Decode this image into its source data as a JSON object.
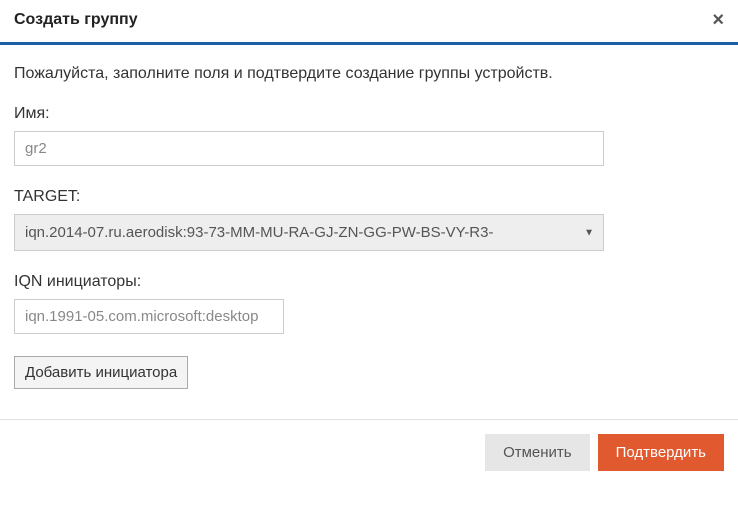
{
  "header": {
    "title": "Создать группу",
    "close_symbol": "×"
  },
  "body": {
    "description": "Пожалуйста, заполните поля и подтвердите создание группы устройств.",
    "name_label": "Имя:",
    "name_value": "gr2",
    "target_label": "TARGET:",
    "target_value": "iqn.2014-07.ru.aerodisk:93-73-MM-MU-RA-GJ-ZN-GG-PW-BS-VY-R3-",
    "iqn_label": "IQN инициаторы:",
    "iqn_value": "iqn.1991-05.com.microsoft:desktop",
    "iqn_display": "iqn.1991-05.com.microsoft:deskto",
    "add_initiator_label": "Добавить инициатора"
  },
  "footer": {
    "cancel_label": "Отменить",
    "confirm_label": "Подтвердить"
  }
}
